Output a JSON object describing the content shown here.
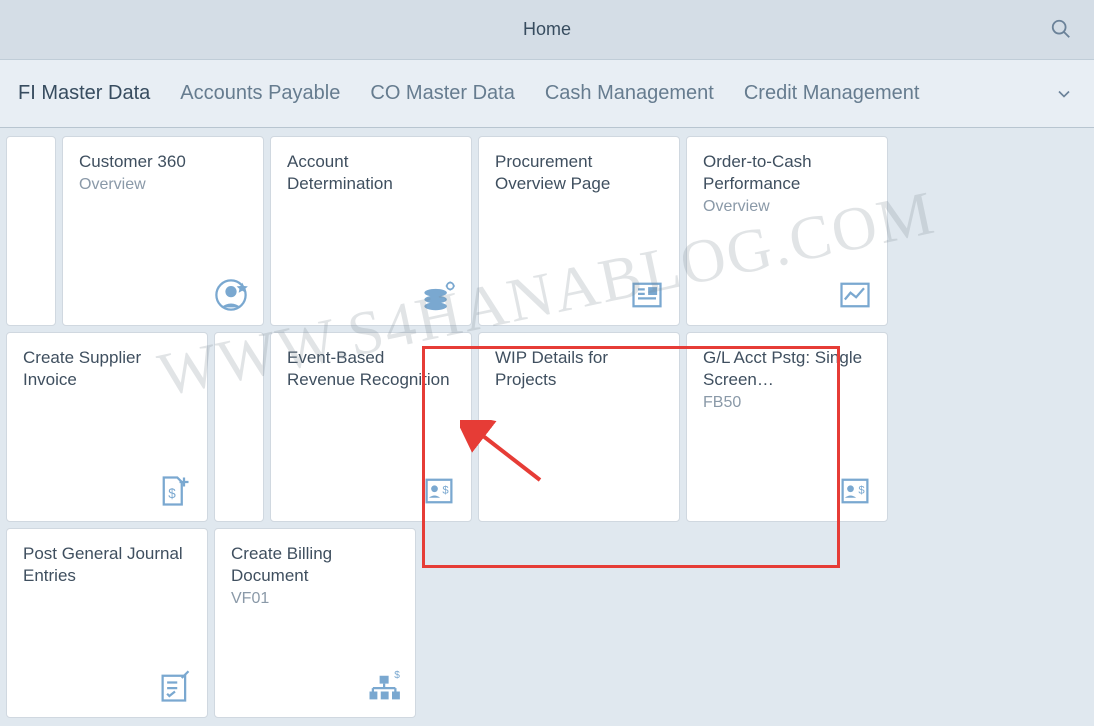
{
  "header": {
    "title": "Home"
  },
  "tabs": [
    {
      "label": "FI Master Data"
    },
    {
      "label": "Accounts Payable"
    },
    {
      "label": "CO Master Data"
    },
    {
      "label": "Cash Management"
    },
    {
      "label": "Credit Management"
    }
  ],
  "tiles": [
    {
      "title": "Customer 360",
      "subtitle": "Overview"
    },
    {
      "title": "Account Determination",
      "subtitle": ""
    },
    {
      "title": "Procurement Overview Page",
      "subtitle": ""
    },
    {
      "title": "Order-to-Cash Performance",
      "subtitle": "Overview"
    },
    {
      "title": "Create Supplier Invoice",
      "subtitle": ""
    },
    {
      "title": "Event-Based Revenue Recognition",
      "subtitle": ""
    },
    {
      "title": "WIP Details for Projects",
      "subtitle": ""
    },
    {
      "title": "G/L Acct Pstg: Single Screen…",
      "subtitle": "FB50"
    },
    {
      "title": "Post General Journal Entries",
      "subtitle": ""
    },
    {
      "title": "Create Billing Document",
      "subtitle": "VF01"
    }
  ],
  "watermark": "WWW.S4HANABLOG.COM"
}
